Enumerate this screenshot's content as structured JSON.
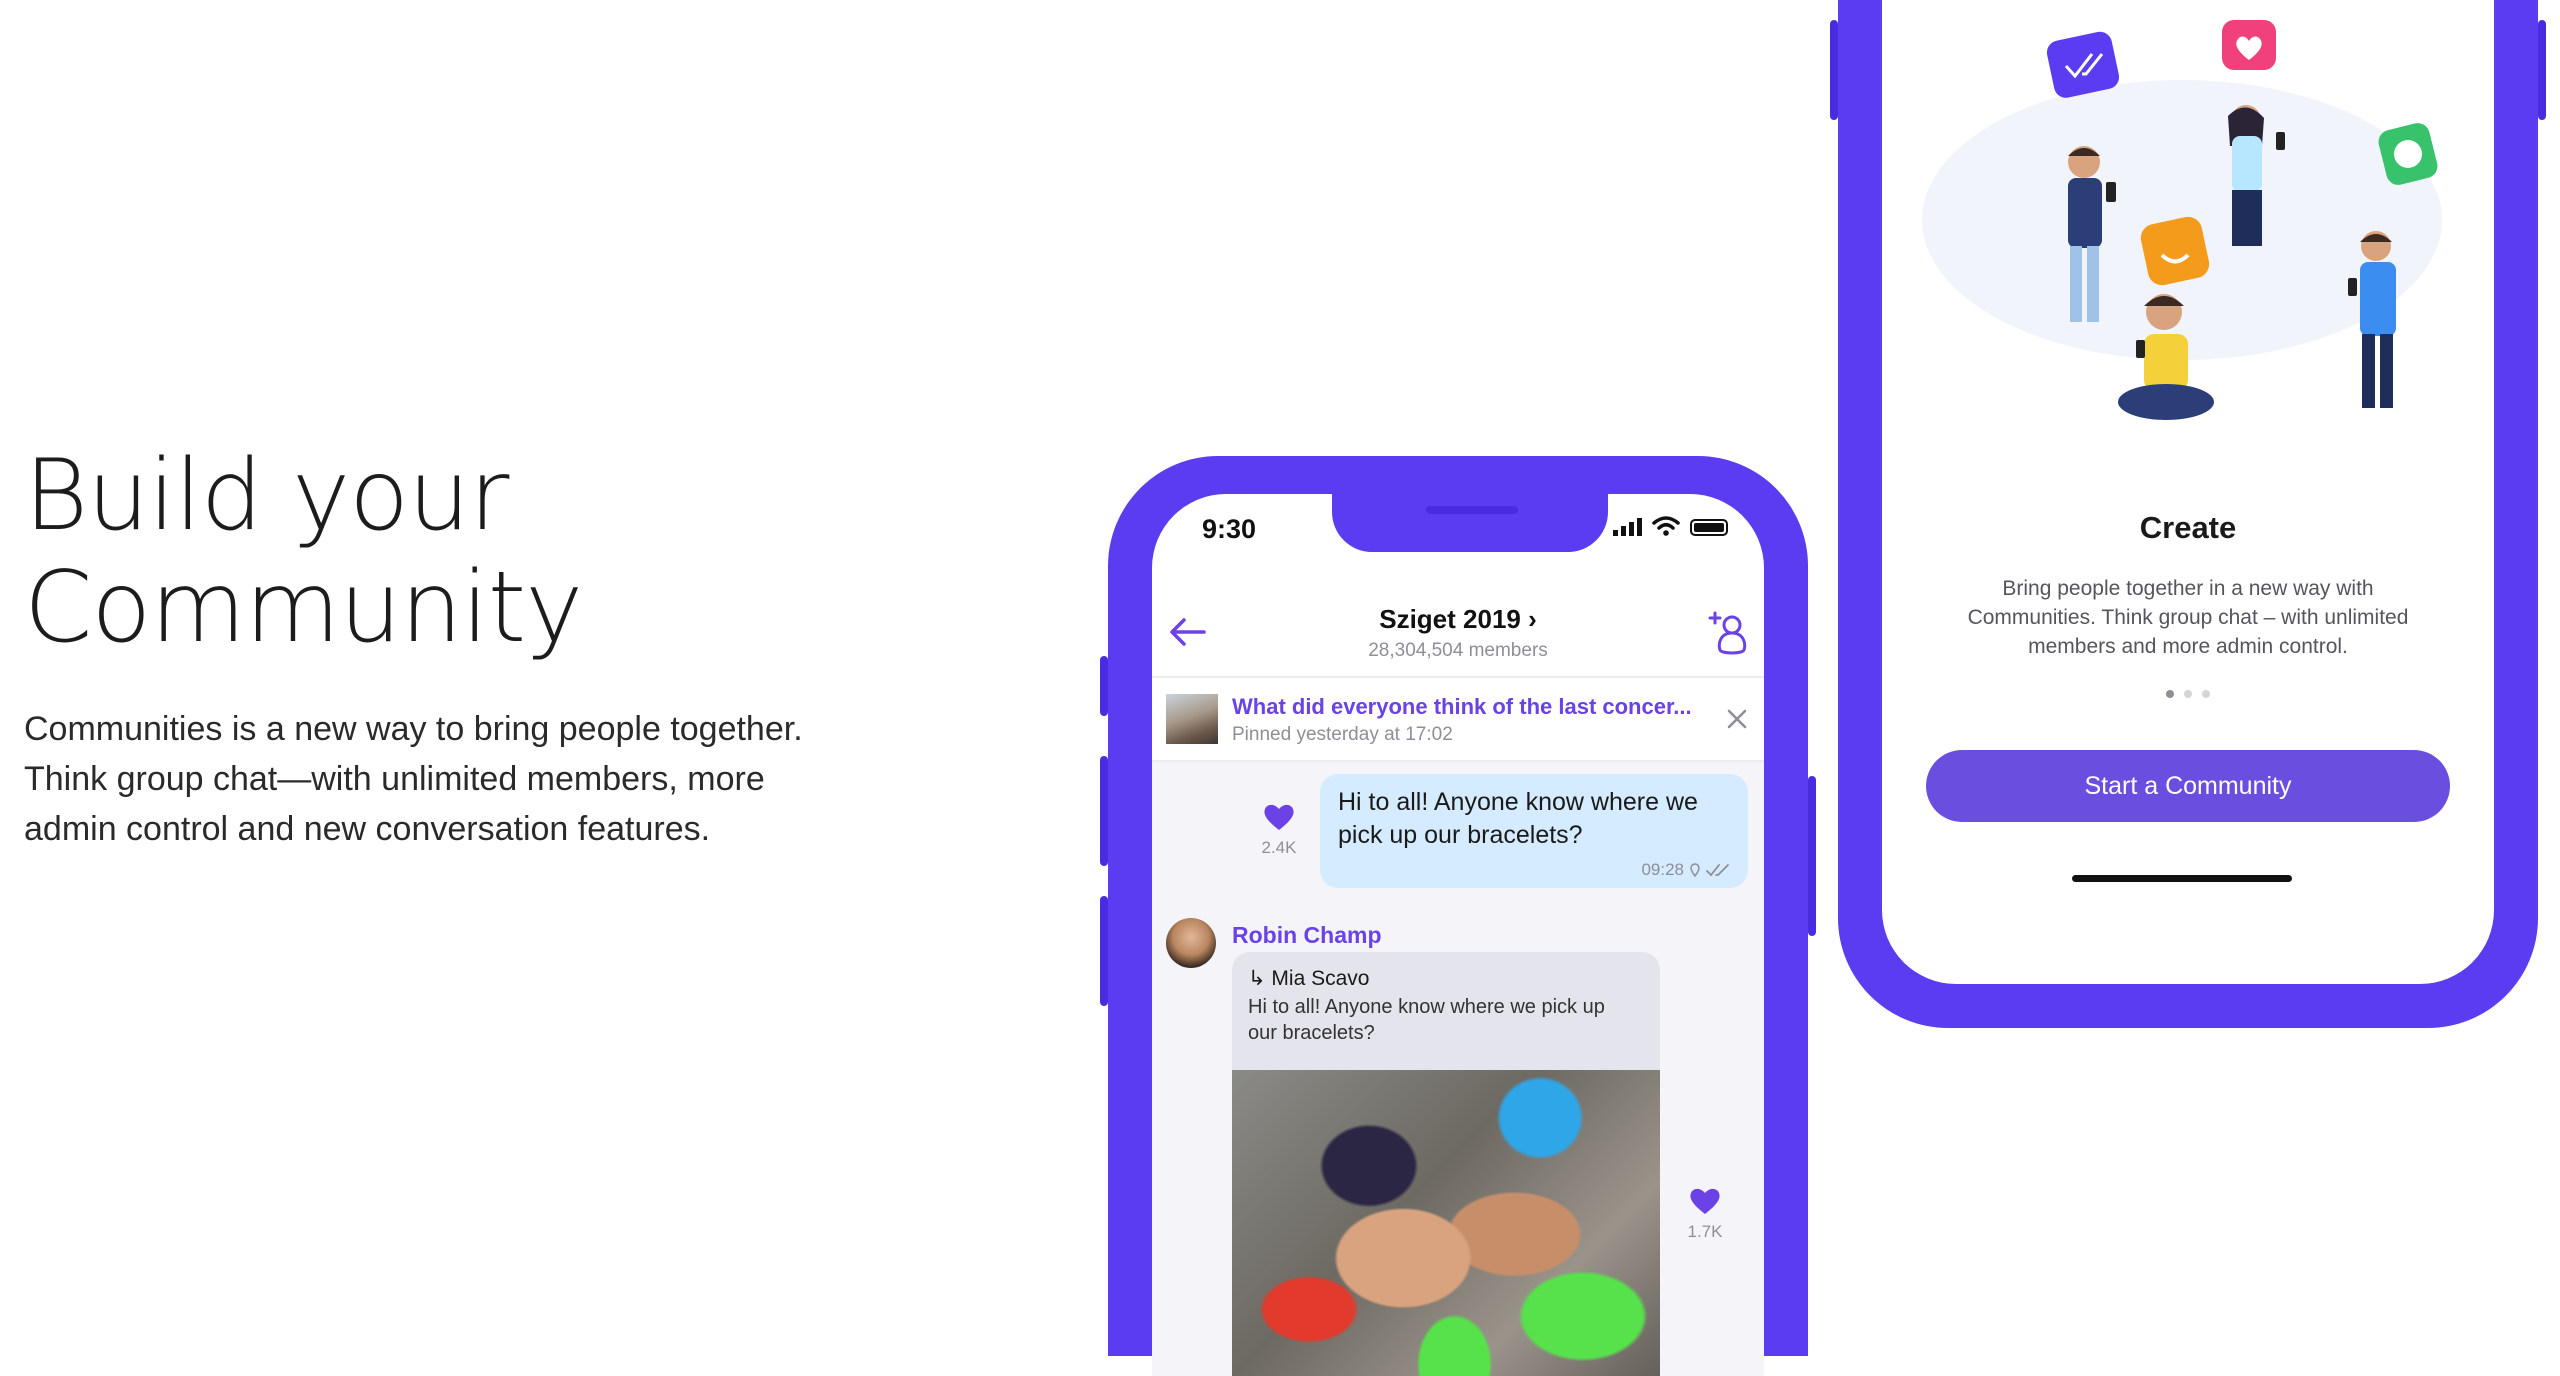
{
  "hero": {
    "title_line1": "Build your",
    "title_line2": "Community",
    "desc_line1": "Communities is a new way to bring people together.",
    "desc_line2": "Think group chat—with unlimited members, more",
    "desc_line3": "admin control and new conversation features."
  },
  "phone_chat": {
    "status_time": "9:30",
    "header": {
      "title": "Sziget 2019 ›",
      "subtitle": "28,304,504 members",
      "back_icon": "arrow-left-icon",
      "add_icon": "add-member-icon"
    },
    "pinned": {
      "title": "What did everyone think of the last concer...",
      "subtitle": "Pinned yesterday at 17:02"
    },
    "outgoing": {
      "text": "Hi to all! Anyone know where we pick up our bracelets?",
      "time": "09:28",
      "likes": "2.4K"
    },
    "incoming": {
      "sender": "Robin Champ",
      "reply_to": "↳ Mia Scavo",
      "reply_text": "Hi to all! Anyone know where we pick up our bracelets?",
      "likes": "1.7K"
    }
  },
  "phone_onboarding": {
    "title": "Create",
    "desc_line1": "Bring people together in a new way with",
    "desc_line2": "Communities. Think group chat – with unlimited",
    "desc_line3": "members and more admin control.",
    "button_label": "Start a Community",
    "page_count": 3,
    "active_page": 1
  },
  "colors": {
    "brand": "#5b3cf0",
    "accent_text": "#6a42e6",
    "bubble_out": "#d5ebff",
    "bubble_in": "#e4e4ec",
    "button": "#6a4ee0"
  }
}
